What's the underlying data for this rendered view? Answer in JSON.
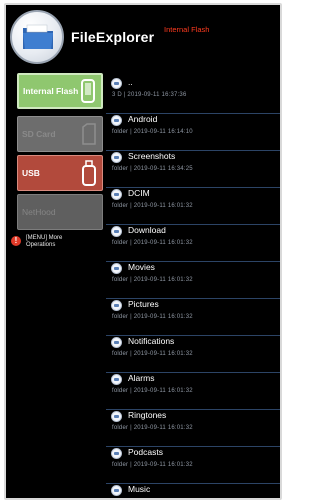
{
  "header": {
    "app_title": "FileExplorer",
    "location": "Internal Flash"
  },
  "storage": {
    "internal_label": "Internal Flash",
    "sd_label": "SD Card",
    "usb_label": "USB",
    "net_label": "NetHood"
  },
  "notice": {
    "text": "[MENU] More Operations"
  },
  "files": [
    {
      "name": "..",
      "meta": "3 D | 2019-09-11 16:37:36"
    },
    {
      "name": "Android",
      "meta": "folder | 2019-09-11 16:14:10"
    },
    {
      "name": "Screenshots",
      "meta": "folder | 2019-09-11 16:34:25"
    },
    {
      "name": "DCIM",
      "meta": "folder | 2019-09-11 16:01:32"
    },
    {
      "name": "Download",
      "meta": "folder | 2019-09-11 16:01:32"
    },
    {
      "name": "Movies",
      "meta": "folder | 2019-09-11 16:01:32"
    },
    {
      "name": "Pictures",
      "meta": "folder | 2019-09-11 16:01:32"
    },
    {
      "name": "Notifications",
      "meta": "folder | 2019-09-11 16:01:32"
    },
    {
      "name": "Alarms",
      "meta": "folder | 2019-09-11 16:01:32"
    },
    {
      "name": "Ringtones",
      "meta": "folder | 2019-09-11 16:01:32"
    },
    {
      "name": "Podcasts",
      "meta": "folder | 2019-09-11 16:01:32"
    },
    {
      "name": "Music",
      "meta": ""
    }
  ],
  "colors": {
    "background": "#000000",
    "internal_active": "#8fc76f",
    "usb": "#b24a3c",
    "location_accent": "#ff3b1f"
  },
  "icons": {
    "logo": "folder-icon",
    "internal": "phone-icon",
    "usb": "usb-drive-icon",
    "notice": "exclamation-icon",
    "file": "folder-icon"
  }
}
